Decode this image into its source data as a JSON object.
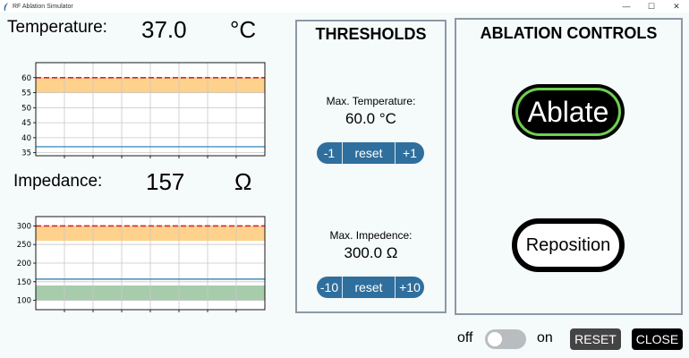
{
  "window": {
    "title": "RF Ablation Simulator",
    "minimize": "—",
    "maximize": "☐",
    "close": "✕"
  },
  "temperature": {
    "label": "Temperature:",
    "value": "37.0",
    "unit": "°C"
  },
  "impedance": {
    "label": "Impedance:",
    "value": "157",
    "unit": "Ω"
  },
  "thresholds": {
    "title": "THRESHOLDS",
    "temp": {
      "label": "Max. Temperature:",
      "value": "60.0 °C",
      "dec": "-1",
      "reset": "reset",
      "inc": "+1"
    },
    "imp": {
      "label": "Max. Impedence:",
      "value": "300.0 Ω",
      "dec": "-10",
      "reset": "reset",
      "inc": "+10"
    }
  },
  "ablation": {
    "title": "ABLATION CONTROLS",
    "ablate": "Ablate",
    "reposition": "Reposition"
  },
  "toggle": {
    "off": "off",
    "on": "on",
    "state": "off"
  },
  "buttons": {
    "reset": "RESET",
    "close": "CLOSE"
  },
  "colors": {
    "accent": "#2f6f9d",
    "warning_band": "#fed18c",
    "normal_band": "#a7ccac",
    "threshold_line": "#d62728",
    "series_line": "#1f77b4",
    "ablate_ring": "#6fcf4f"
  },
  "chart_data": [
    {
      "type": "line",
      "yticks": [
        35,
        40,
        45,
        50,
        55,
        60
      ],
      "ylim": [
        34,
        65
      ],
      "threshold": 60,
      "warning_band": [
        55,
        60
      ],
      "series": [
        {
          "values": [
            37,
            37
          ]
        }
      ],
      "grid": true
    },
    {
      "type": "line",
      "yticks": [
        100,
        150,
        200,
        250,
        300
      ],
      "ylim": [
        75,
        325
      ],
      "threshold": 300,
      "warning_band": [
        260,
        300
      ],
      "normal_band": [
        100,
        140
      ],
      "series": [
        {
          "values": [
            157,
            157
          ]
        }
      ],
      "grid": true
    }
  ]
}
